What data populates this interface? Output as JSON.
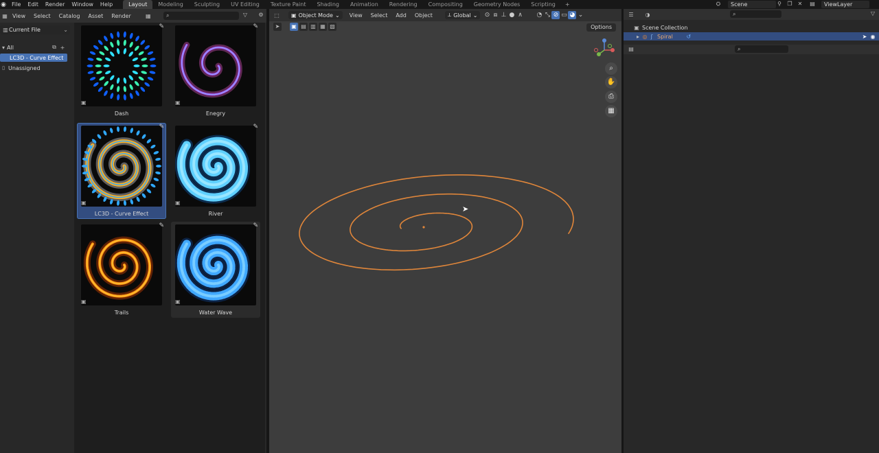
{
  "topbar": {
    "menus": [
      "File",
      "Edit",
      "Render",
      "Window",
      "Help"
    ],
    "workspaces": [
      "Layout",
      "Modeling",
      "Sculpting",
      "UV Editing",
      "Texture Paint",
      "Shading",
      "Animation",
      "Rendering",
      "Compositing",
      "Geometry Nodes",
      "Scripting"
    ],
    "active_workspace": "Layout",
    "add_workspace": "+",
    "scene": "Scene",
    "view_layer": "ViewLayer"
  },
  "asset_browser": {
    "menus": [
      "View",
      "Select",
      "Catalog",
      "Asset",
      "Render"
    ],
    "library": "Current File",
    "catalogs": [
      {
        "label": "All"
      },
      {
        "label": "LC3D - Curve Effect",
        "selected": true
      },
      {
        "label": "Unassigned"
      }
    ],
    "assets": [
      {
        "label": "Dash",
        "colors": [
          "#2fe0ff",
          "#3af0b0",
          "#1060ff"
        ]
      },
      {
        "label": "Enegry",
        "colors": [
          "#b050ff",
          "#80c8ff",
          "#ff60e0"
        ]
      },
      {
        "label": "LC3D - Curve Effect",
        "colors": [
          "#ffb020",
          "#2fa8ff",
          "#ffffff"
        ],
        "selected": true
      },
      {
        "label": "River",
        "colors": [
          "#5fd0ff",
          "#a0e8ff",
          "#1070d0"
        ]
      },
      {
        "label": "Trails",
        "colors": [
          "#ff9010",
          "#ffd040",
          "#ff5000"
        ]
      },
      {
        "label": "Water Wave",
        "colors": [
          "#40a8ff",
          "#80d0ff",
          "#1050b0"
        ]
      }
    ]
  },
  "viewport": {
    "menus": [
      "View",
      "Select",
      "Add",
      "Object"
    ],
    "mode": "Object Mode",
    "transform_orientation": "Global",
    "options": "Options",
    "curve_color": "#e0863a"
  },
  "outliner": {
    "collection": "Scene Collection",
    "object": "Spiral"
  },
  "accent": "#4772b3"
}
